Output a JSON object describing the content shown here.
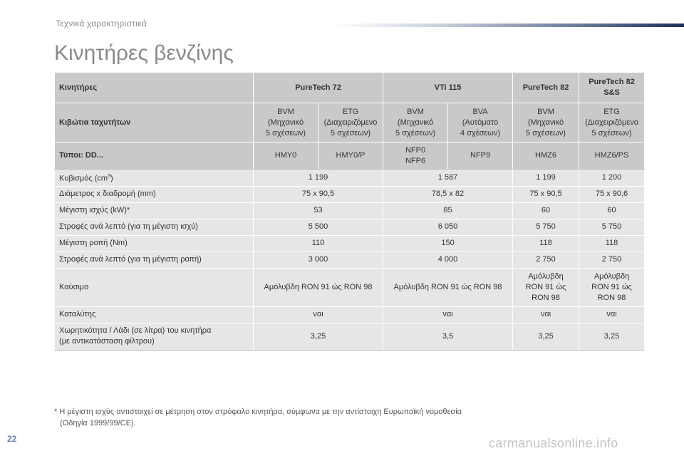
{
  "header": {
    "section": "Τεχνικά χαρακτηριστικά",
    "title": "Κινητήρες βενζίνης"
  },
  "table": {
    "row_engines": {
      "label": "Κινητήρες",
      "c1": "PureTech 72",
      "c2": "VTi 115",
      "c3": "PureTech 82",
      "c4": "PureTech 82 S&S"
    },
    "row_gearbox": {
      "label": "Κιβώτια ταχυτήτων",
      "g1": [
        "BVM",
        "(Μηχανικό",
        "5 σχέσεων)"
      ],
      "g2": [
        "ETG",
        "(Διαχειριζόμενο",
        "5 σχέσεων)"
      ],
      "g3": [
        "BVM",
        "(Μηχανικό",
        "5 σχέσεων)"
      ],
      "g4": [
        "BVA",
        "(Αυτόματο",
        "4 σχέσεων)"
      ],
      "g5": [
        "BVM",
        "(Μηχανικό",
        "5 σχέσεων)"
      ],
      "g6": [
        "ETG",
        "(Διαχειριζόμενο",
        "5 σχέσεων)"
      ]
    },
    "row_types": {
      "label": "Τύποι: DD...",
      "t1": "HMY0",
      "t2": "HMY0/P",
      "t3a": "NFP0",
      "t3b": "NFP6",
      "t4": "NFP9",
      "t5": "HMZ6",
      "t6": "HMZ6/PS"
    },
    "displacement": {
      "label": "Κυβισμός (cm",
      "sup": "3",
      "close": ")",
      "c1": "1 199",
      "c2": "1 587",
      "c3": "1 199",
      "c4": "1 200"
    },
    "bore_stroke": {
      "label": "Διάμετρος x διαδρομή (mm)",
      "c1": "75 x 90,5",
      "c2": "78,5 x 82",
      "c3": "75 x 90,5",
      "c4": "75 x 90,6"
    },
    "max_power": {
      "label": "Μέγιστη ισχύς (kW)*",
      "c1": "53",
      "c2": "85",
      "c3": "60",
      "c4": "60"
    },
    "rpm_power": {
      "label": "Στροφές ανά λεπτό (για τη μέγιστη ισχύ)",
      "c1": "5 500",
      "c2": "6 050",
      "c3": "5 750",
      "c4": "5 750"
    },
    "max_torque": {
      "label": "Μέγιστη ροπή (Nm)",
      "c1": "110",
      "c2": "150",
      "c3": "118",
      "c4": "118"
    },
    "rpm_torque": {
      "label": "Στροφές ανά λεπτό (για τη μέγιστη ροπή)",
      "c1": "3 000",
      "c2": "4 000",
      "c3": "2 750",
      "c4": "2 750"
    },
    "fuel": {
      "label": "Καύσιμο",
      "c1": "Αμόλυβδη RON 91 ώς RON 98",
      "c2": "Αμόλυβδη RON 91 ώς RON 98",
      "c3": [
        "Αμόλυβδη",
        "RON 91 ώς",
        "RON 98"
      ],
      "c4": [
        "Αμόλυβδη",
        "RON 91 ώς",
        "RON 98"
      ]
    },
    "catalyst": {
      "label": "Καταλύτης",
      "c1": "ναι",
      "c2": "ναι",
      "c3": "ναι",
      "c4": "ναι"
    },
    "oil_capacity": {
      "label_l1": "Χωρητικότητα / Λάδι (σε λίτρα) του κινητήρα",
      "label_l2": "(με αντικατάσταση φίλτρου)",
      "c1": "3,25",
      "c2": "3,5",
      "c3": "3,25",
      "c4": "3,25"
    }
  },
  "footnote": {
    "line1": "* Η μέγιστη ισχύς αντιστοιχεί σε μέτρηση στον στρόφαλο κινητήρα, σύμφωνα με την αντίστοιχη Ευρωπαϊκή νομοθεσία",
    "line2": "(Οδηγία 1999/99/CE)."
  },
  "page_number": "22",
  "watermark": "carmanualsonline.info"
}
